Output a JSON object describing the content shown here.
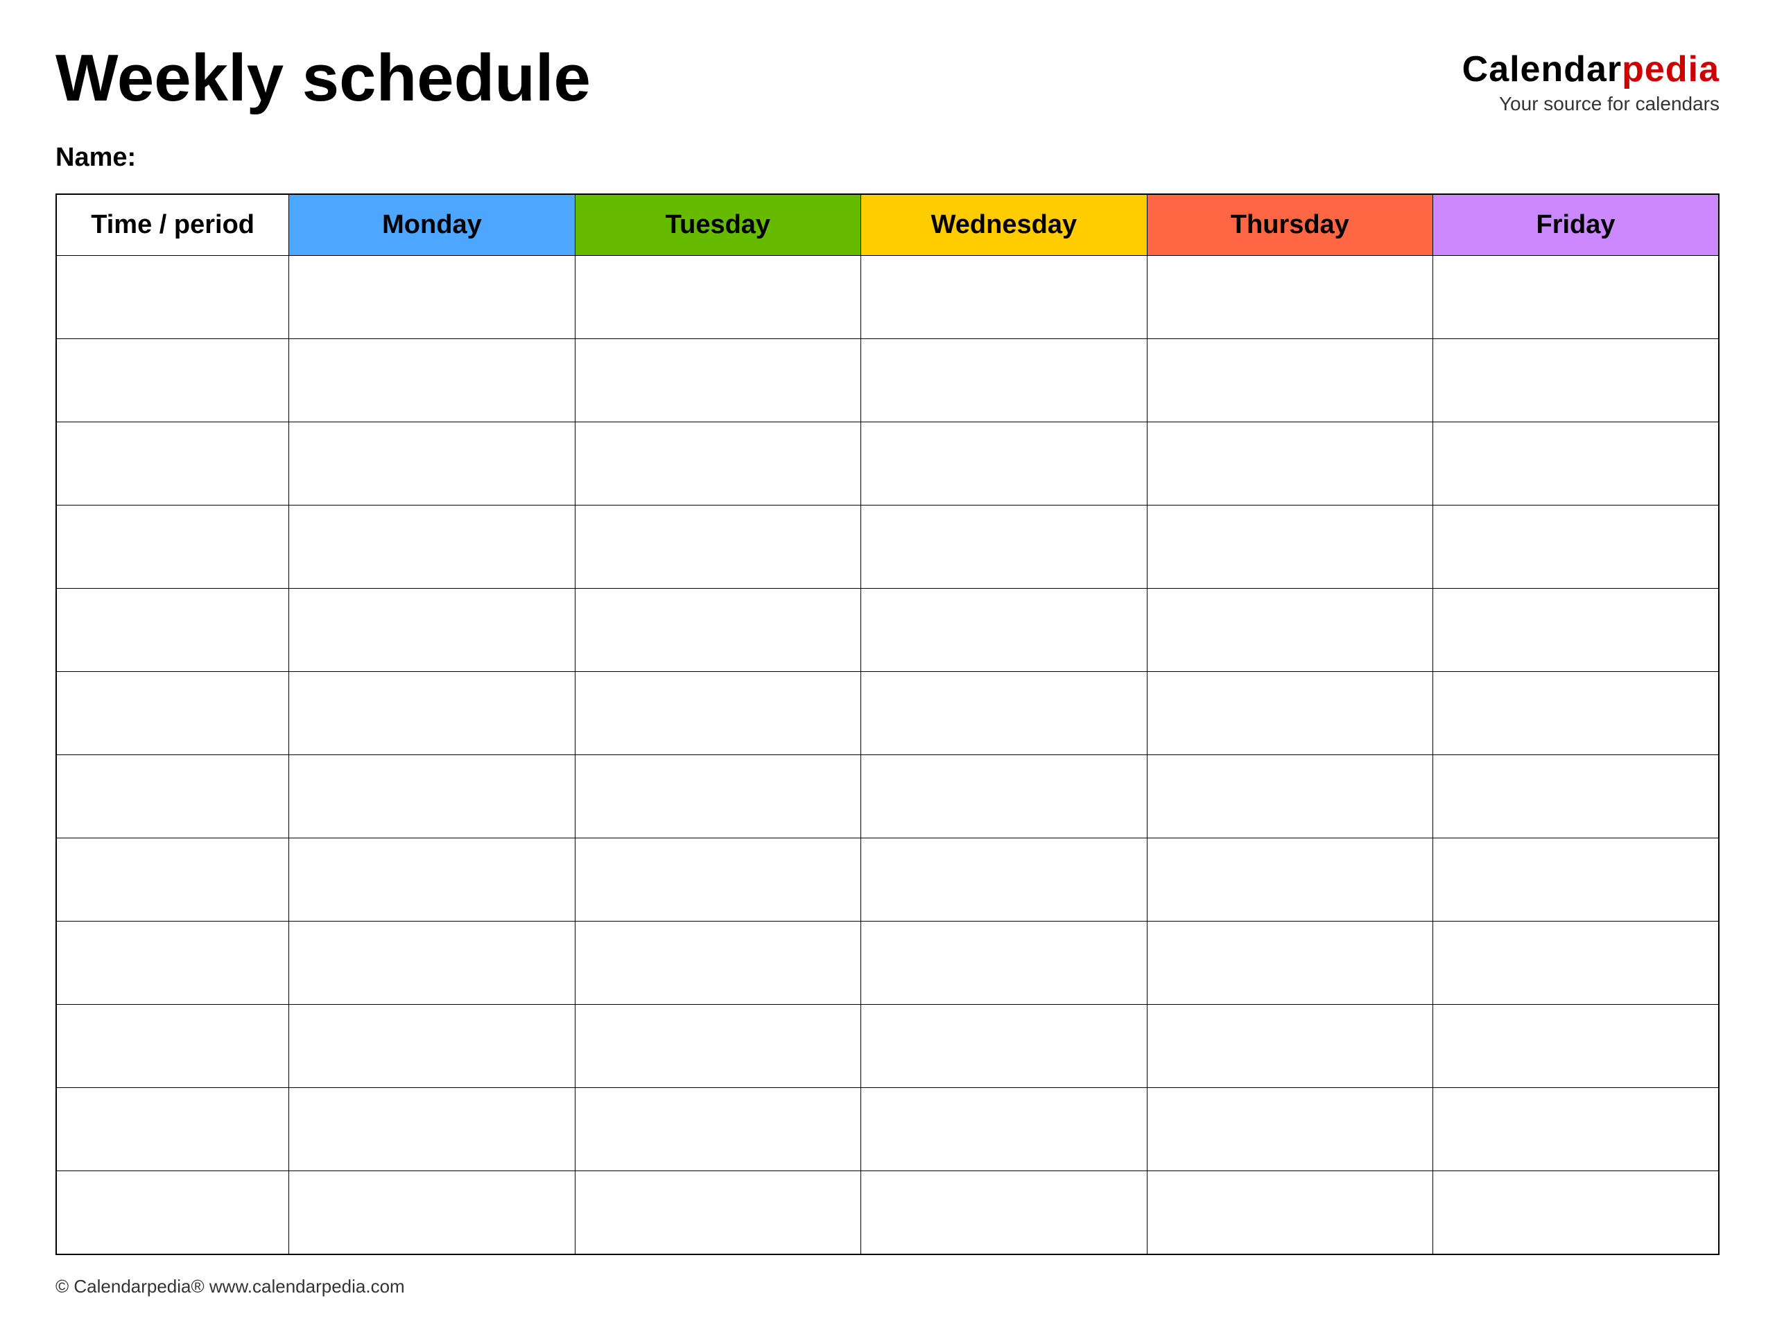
{
  "header": {
    "title": "Weekly schedule",
    "brand": {
      "calendar_part": "Calendar",
      "pedia_part": "pedia",
      "tagline": "Your source for calendars"
    },
    "name_label": "Name:"
  },
  "table": {
    "columns": [
      {
        "key": "time",
        "label": "Time / period",
        "color": "#ffffff",
        "text_color": "#000000",
        "class": "th-time"
      },
      {
        "key": "monday",
        "label": "Monday",
        "color": "#4da6ff",
        "text_color": "#000000",
        "class": "th-monday"
      },
      {
        "key": "tuesday",
        "label": "Tuesday",
        "color": "#66bb00",
        "text_color": "#000000",
        "class": "th-tuesday"
      },
      {
        "key": "wednesday",
        "label": "Wednesday",
        "color": "#ffcc00",
        "text_color": "#000000",
        "class": "th-wednesday"
      },
      {
        "key": "thursday",
        "label": "Thursday",
        "color": "#ff6644",
        "text_color": "#000000",
        "class": "th-thursday"
      },
      {
        "key": "friday",
        "label": "Friday",
        "color": "#cc88ff",
        "text_color": "#000000",
        "class": "th-friday"
      }
    ],
    "row_count": 12
  },
  "footer": {
    "text": "© Calendarpedia®  www.calendarpedia.com"
  }
}
